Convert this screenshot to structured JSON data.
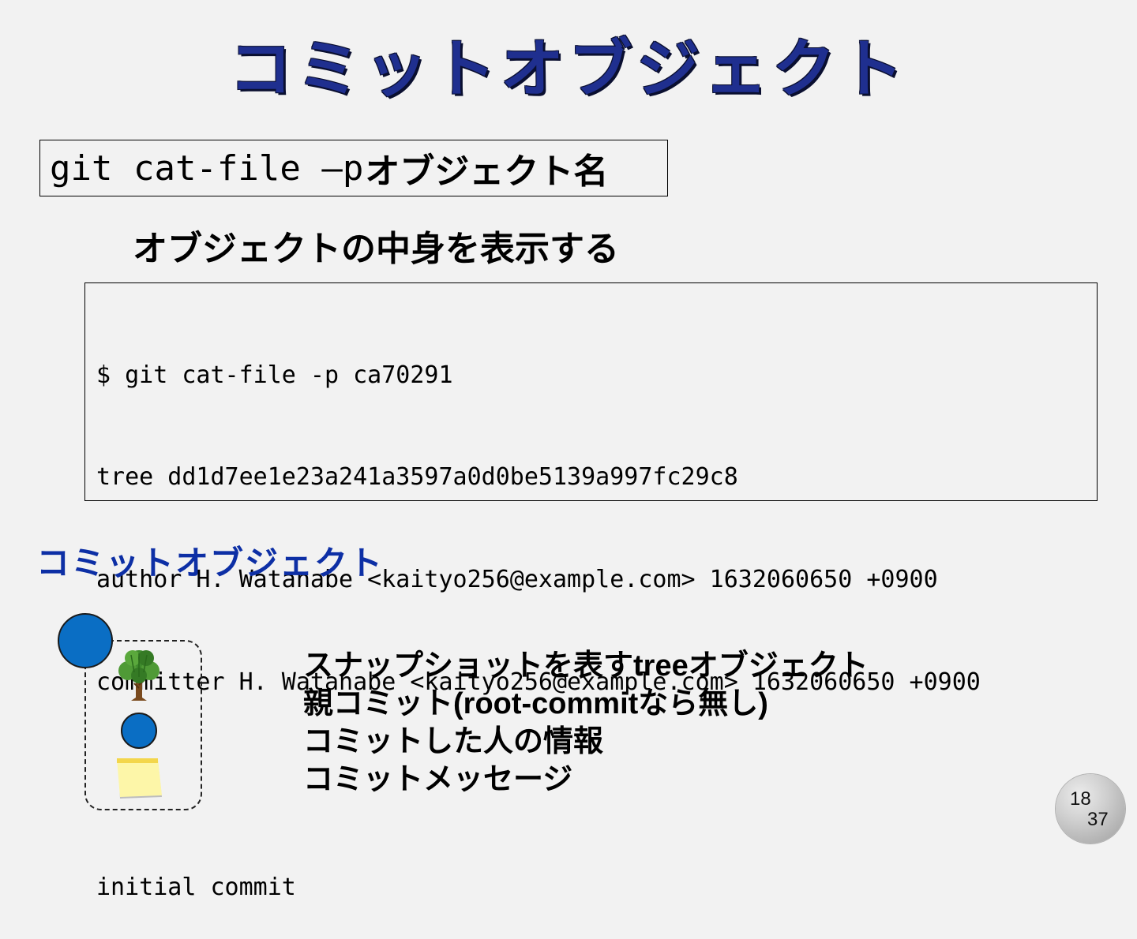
{
  "title": "コミットオブジェクト",
  "command": {
    "mono": "git cat-file –p ",
    "jp": "オブジェクト名"
  },
  "description": "オブジェクトの中身を表示する",
  "terminal": {
    "lines": [
      "$ git cat-file -p ca70291",
      "tree dd1d7ee1e23a241a3597a0d0be5139a997fc29c8",
      "author H. Watanabe <kaityo256@example.com> 1632060650 +0900",
      "committer H. Watanabe <kaityo256@example.com> 1632060650 +0900",
      "",
      "initial commit"
    ]
  },
  "subheading": "コミットオブジェクト",
  "diagram": {
    "icons": [
      "commit-circle-icon",
      "tree-icon",
      "parent-commit-circle-icon",
      "sticky-note-icon"
    ],
    "colors": {
      "commit_fill": "#0a6ec4",
      "tree_leaves": "#3e8a2c",
      "tree_trunk": "#7a4a1e",
      "note_fill": "#fdf6a8",
      "note_tape": "#f3d64b"
    }
  },
  "bullets": [
    "スナップショットを表すtreeオブジェクト",
    "親コミット(root-commitなら無し)",
    "コミットした人の情報",
    "コミットメッセージ"
  ],
  "page": {
    "current": "18",
    "total": "37"
  },
  "colors": {
    "background": "#f2f2f2",
    "title": "#1f2f8f",
    "subheading": "#0d2fa5"
  }
}
